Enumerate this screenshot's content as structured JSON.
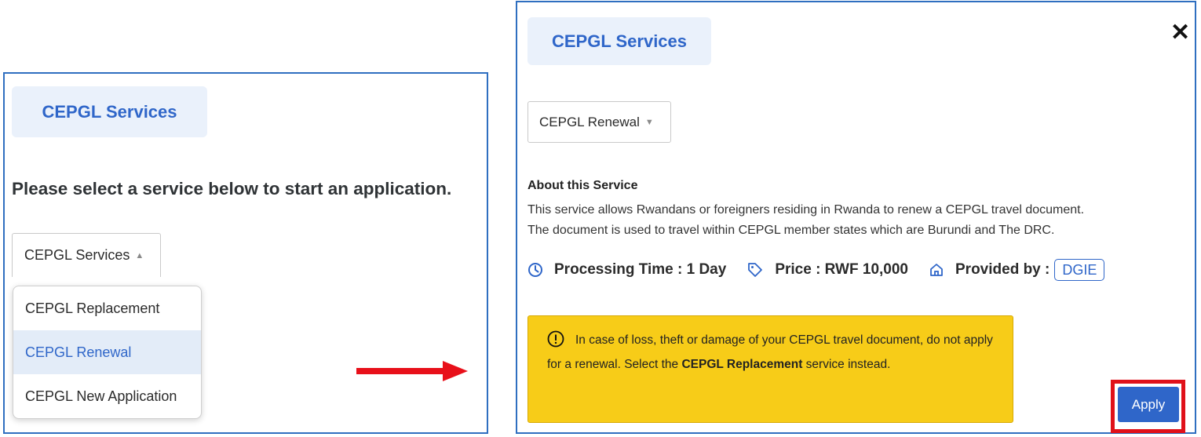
{
  "left": {
    "services_label": "CEPGL Services",
    "prompt": "Please select a service below to start an application.",
    "select_value": "CEPGL Services",
    "options": [
      {
        "label": "CEPGL Replacement"
      },
      {
        "label": "CEPGL Renewal"
      },
      {
        "label": "CEPGL New Application"
      }
    ]
  },
  "right": {
    "services_label": "CEPGL Services",
    "close_icon": "close-icon",
    "select_value": "CEPGL Renewal",
    "about_title": "About this Service",
    "about_line1": "This service allows Rwandans or foreigners residing in Rwanda to renew a CEPGL travel document.",
    "about_line2": "The document is used to travel within CEPGL member states which are Burundi and The DRC.",
    "processing_time": "Processing Time : 1 Day",
    "price": "Price : RWF 10,000",
    "provided_by": "Provided by :",
    "provider": "DGIE",
    "warning_part1": "In case of loss, theft or damage of your CEPGL travel document, do not apply for a renewal. Select the ",
    "warning_bold": "CEPGL Replacement",
    "warning_part2": " service instead.",
    "apply_label": "Apply"
  },
  "colors": {
    "accent_blue": "#2f66c9",
    "panel_border": "#2f6fc0",
    "warning_bg": "#f7cc18",
    "highlight_red": "#e0111a",
    "arrow_red": "#e8101a"
  }
}
